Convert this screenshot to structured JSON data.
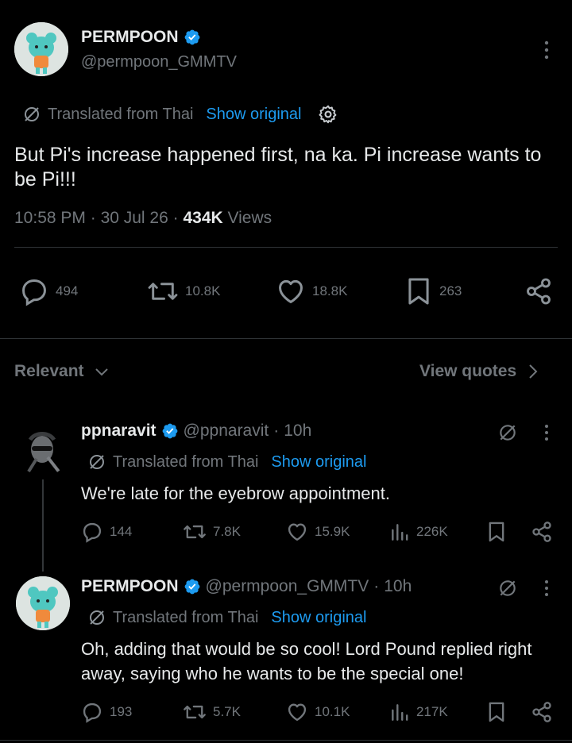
{
  "main_tweet": {
    "author_name": "PERMPOON",
    "author_handle": "@permpoon_GMMTV",
    "translated_label": "Translated from Thai",
    "show_original": "Show original",
    "text": "But Pi's increase happened first, na ka. Pi increase wants to be Pi!!!",
    "time": "10:58 PM",
    "date": "30 Jul 26",
    "views_count": "434K",
    "views_label": "Views",
    "replies": "494",
    "retweets": "10.8K",
    "likes": "18.8K",
    "bookmarks": "263"
  },
  "filter": {
    "sort_label": "Relevant",
    "view_quotes": "View quotes"
  },
  "replies": [
    {
      "name": "ppnaravit",
      "handle": "@ppnaravit",
      "time": "10h",
      "translated_label": "Translated from Thai",
      "show_original": "Show original",
      "text": "We're late for the eyebrow appointment.",
      "replies": "144",
      "retweets": "7.8K",
      "likes": "15.9K",
      "views": "226K"
    },
    {
      "name": "PERMPOON",
      "handle": "@permpoon_GMMTV",
      "time": "10h",
      "translated_label": "Translated from Thai",
      "show_original": "Show original",
      "text": "Oh, adding that would be so cool! Lord Pound replied right away, saying who he wants to be the special one!",
      "replies": "193",
      "retweets": "5.7K",
      "likes": "10.1K",
      "views": "217K"
    }
  ],
  "colors": {
    "background": "#000000",
    "text_primary": "#e7e9ea",
    "text_secondary": "#71767b",
    "accent_blue": "#1d9bf0",
    "divider": "#2f3336"
  }
}
